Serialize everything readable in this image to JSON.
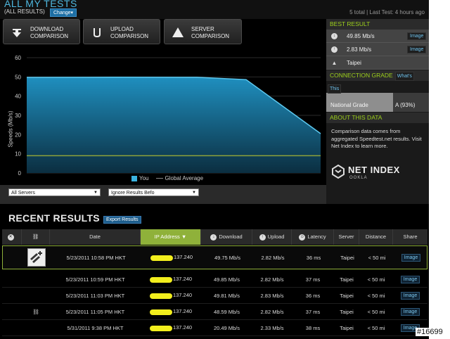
{
  "header": {
    "title": "ALL MY TESTS",
    "subtitle": "(ALL RESULTS)",
    "change_label": "Change",
    "status": "5 total | Last Test: 4 hours ago"
  },
  "tabs": [
    {
      "label_line1": "DOWNLOAD",
      "label_line2": "COMPARISON",
      "icon": "download-icon"
    },
    {
      "label_line1": "UPLOAD",
      "label_line2": "COMPARISON",
      "icon": "upload-icon"
    },
    {
      "label_line1": "SERVER",
      "label_line2": "COMPARISON",
      "icon": "server-icon"
    }
  ],
  "chart_data": {
    "type": "area",
    "ylabel": "Speeds (Mb/s)",
    "ylim": [
      0,
      60
    ],
    "yticks": [
      0,
      10,
      20,
      30,
      40,
      50,
      60
    ],
    "series": [
      {
        "name": "You",
        "values": [
          49.75,
          49.85,
          49.81,
          48.59,
          20.49
        ],
        "color": "#2fa7d6"
      },
      {
        "name": "Global Average",
        "values": [
          9,
          9,
          9,
          9,
          9
        ],
        "color": "#8fa23a"
      }
    ],
    "legend": "bottom-center",
    "grid": true
  },
  "filters": {
    "servers": "All Servers",
    "ignore": "Ignore Results Befo"
  },
  "side": {
    "best_header": "BEST RESULT",
    "best_rows": [
      {
        "value": "49.85 Mb/s",
        "icon": "download-icon",
        "image_label": "Image"
      },
      {
        "value": "2.83 Mb/s",
        "icon": "upload-icon",
        "image_label": "Image"
      },
      {
        "value": "Taipei",
        "icon": "server-icon",
        "image_label": ""
      }
    ],
    "grade_header": "CONNECTION GRADE",
    "whats_label": "What's",
    "this_label": "This",
    "grade_label": "National Grade",
    "grade_value": "A (93%)",
    "about_header": "ABOUT THIS DATA",
    "about_text": "Comparison data comes from aggregated Speedtest.net results. Visit Net Index to learn more.",
    "logo_name": "NET INDEX",
    "logo_sub": "OOKLA"
  },
  "recent": {
    "title": "RECENT RESULTS",
    "export_label": "Export Results",
    "columns": [
      "Date",
      "IP Address ▼",
      "Download",
      "Upload",
      "Latency",
      "Server",
      "Distance",
      "Share"
    ],
    "rows": [
      {
        "date": "5/23/2011 10:58 PM HKT",
        "ip": "137.240",
        "download": "49.75 Mb/s",
        "upload": "2.82 Mb/s",
        "latency": "36 ms",
        "server": "Taipei",
        "distance": "< 50 mi",
        "share": "Image"
      },
      {
        "date": "5/23/2011 10:59 PM HKT",
        "ip": "137.240",
        "download": "49.85 Mb/s",
        "upload": "2.82 Mb/s",
        "latency": "37 ms",
        "server": "Taipei",
        "distance": "< 50 mi",
        "share": "Image"
      },
      {
        "date": "5/23/2011 11:03 PM HKT",
        "ip": "137.240",
        "download": "49.81 Mb/s",
        "upload": "2.83 Mb/s",
        "latency": "36 ms",
        "server": "Taipei",
        "distance": "< 50 mi",
        "share": "Image"
      },
      {
        "date": "5/23/2011 11:05 PM HKT",
        "ip": "137.240",
        "download": "48.59 Mb/s",
        "upload": "2.82 Mb/s",
        "latency": "37 ms",
        "server": "Taipei",
        "distance": "< 50 mi",
        "share": "Image"
      },
      {
        "date": "5/31/2011 9:38 PM HKT",
        "ip": "137.240",
        "download": "20.49 Mb/s",
        "upload": "2.33 Mb/s",
        "latency": "38 ms",
        "server": "Taipei",
        "distance": "< 50 mi",
        "share": "Image"
      }
    ]
  },
  "watermark": "#16699"
}
